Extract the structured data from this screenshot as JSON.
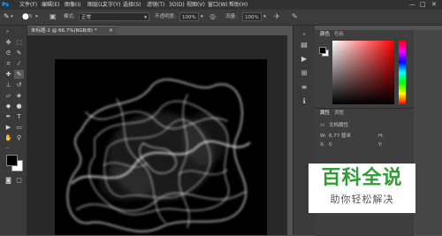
{
  "menubar": {
    "logo": "Ps",
    "items": [
      "文件(F)",
      "编辑(E)",
      "图像(I)",
      "图层(L)",
      "文字(Y)",
      "选择(S)",
      "滤镜(T)",
      "3D(D)",
      "视图(V)",
      "窗口(W)",
      "帮助(H)"
    ]
  },
  "options": {
    "brush_size": "5",
    "mode_label": "模式:",
    "mode_value": "正常",
    "opacity_label": "不透明度:",
    "opacity_value": "100%",
    "flow_label": "流量:",
    "flow_value": "100%"
  },
  "document": {
    "tab_label": "未标题-1 @ 66.7%(RGB/8) *",
    "close": "×"
  },
  "color_panel": {
    "tab_color": "颜色",
    "tab_swatches": "色板",
    "accent": "#ff0000"
  },
  "properties_panel": {
    "tab_properties": "属性",
    "tab_adjust": "调整",
    "doc_props": "文档属性",
    "w_label": "W:",
    "w_value": "6.77 厘米",
    "h_label": "H:",
    "x_label": "X:",
    "x_value": "0",
    "y_label": "Y:"
  },
  "watermark": {
    "title": "百科全说",
    "subtitle": "助你轻松解决",
    "color": "#2e9e32"
  }
}
